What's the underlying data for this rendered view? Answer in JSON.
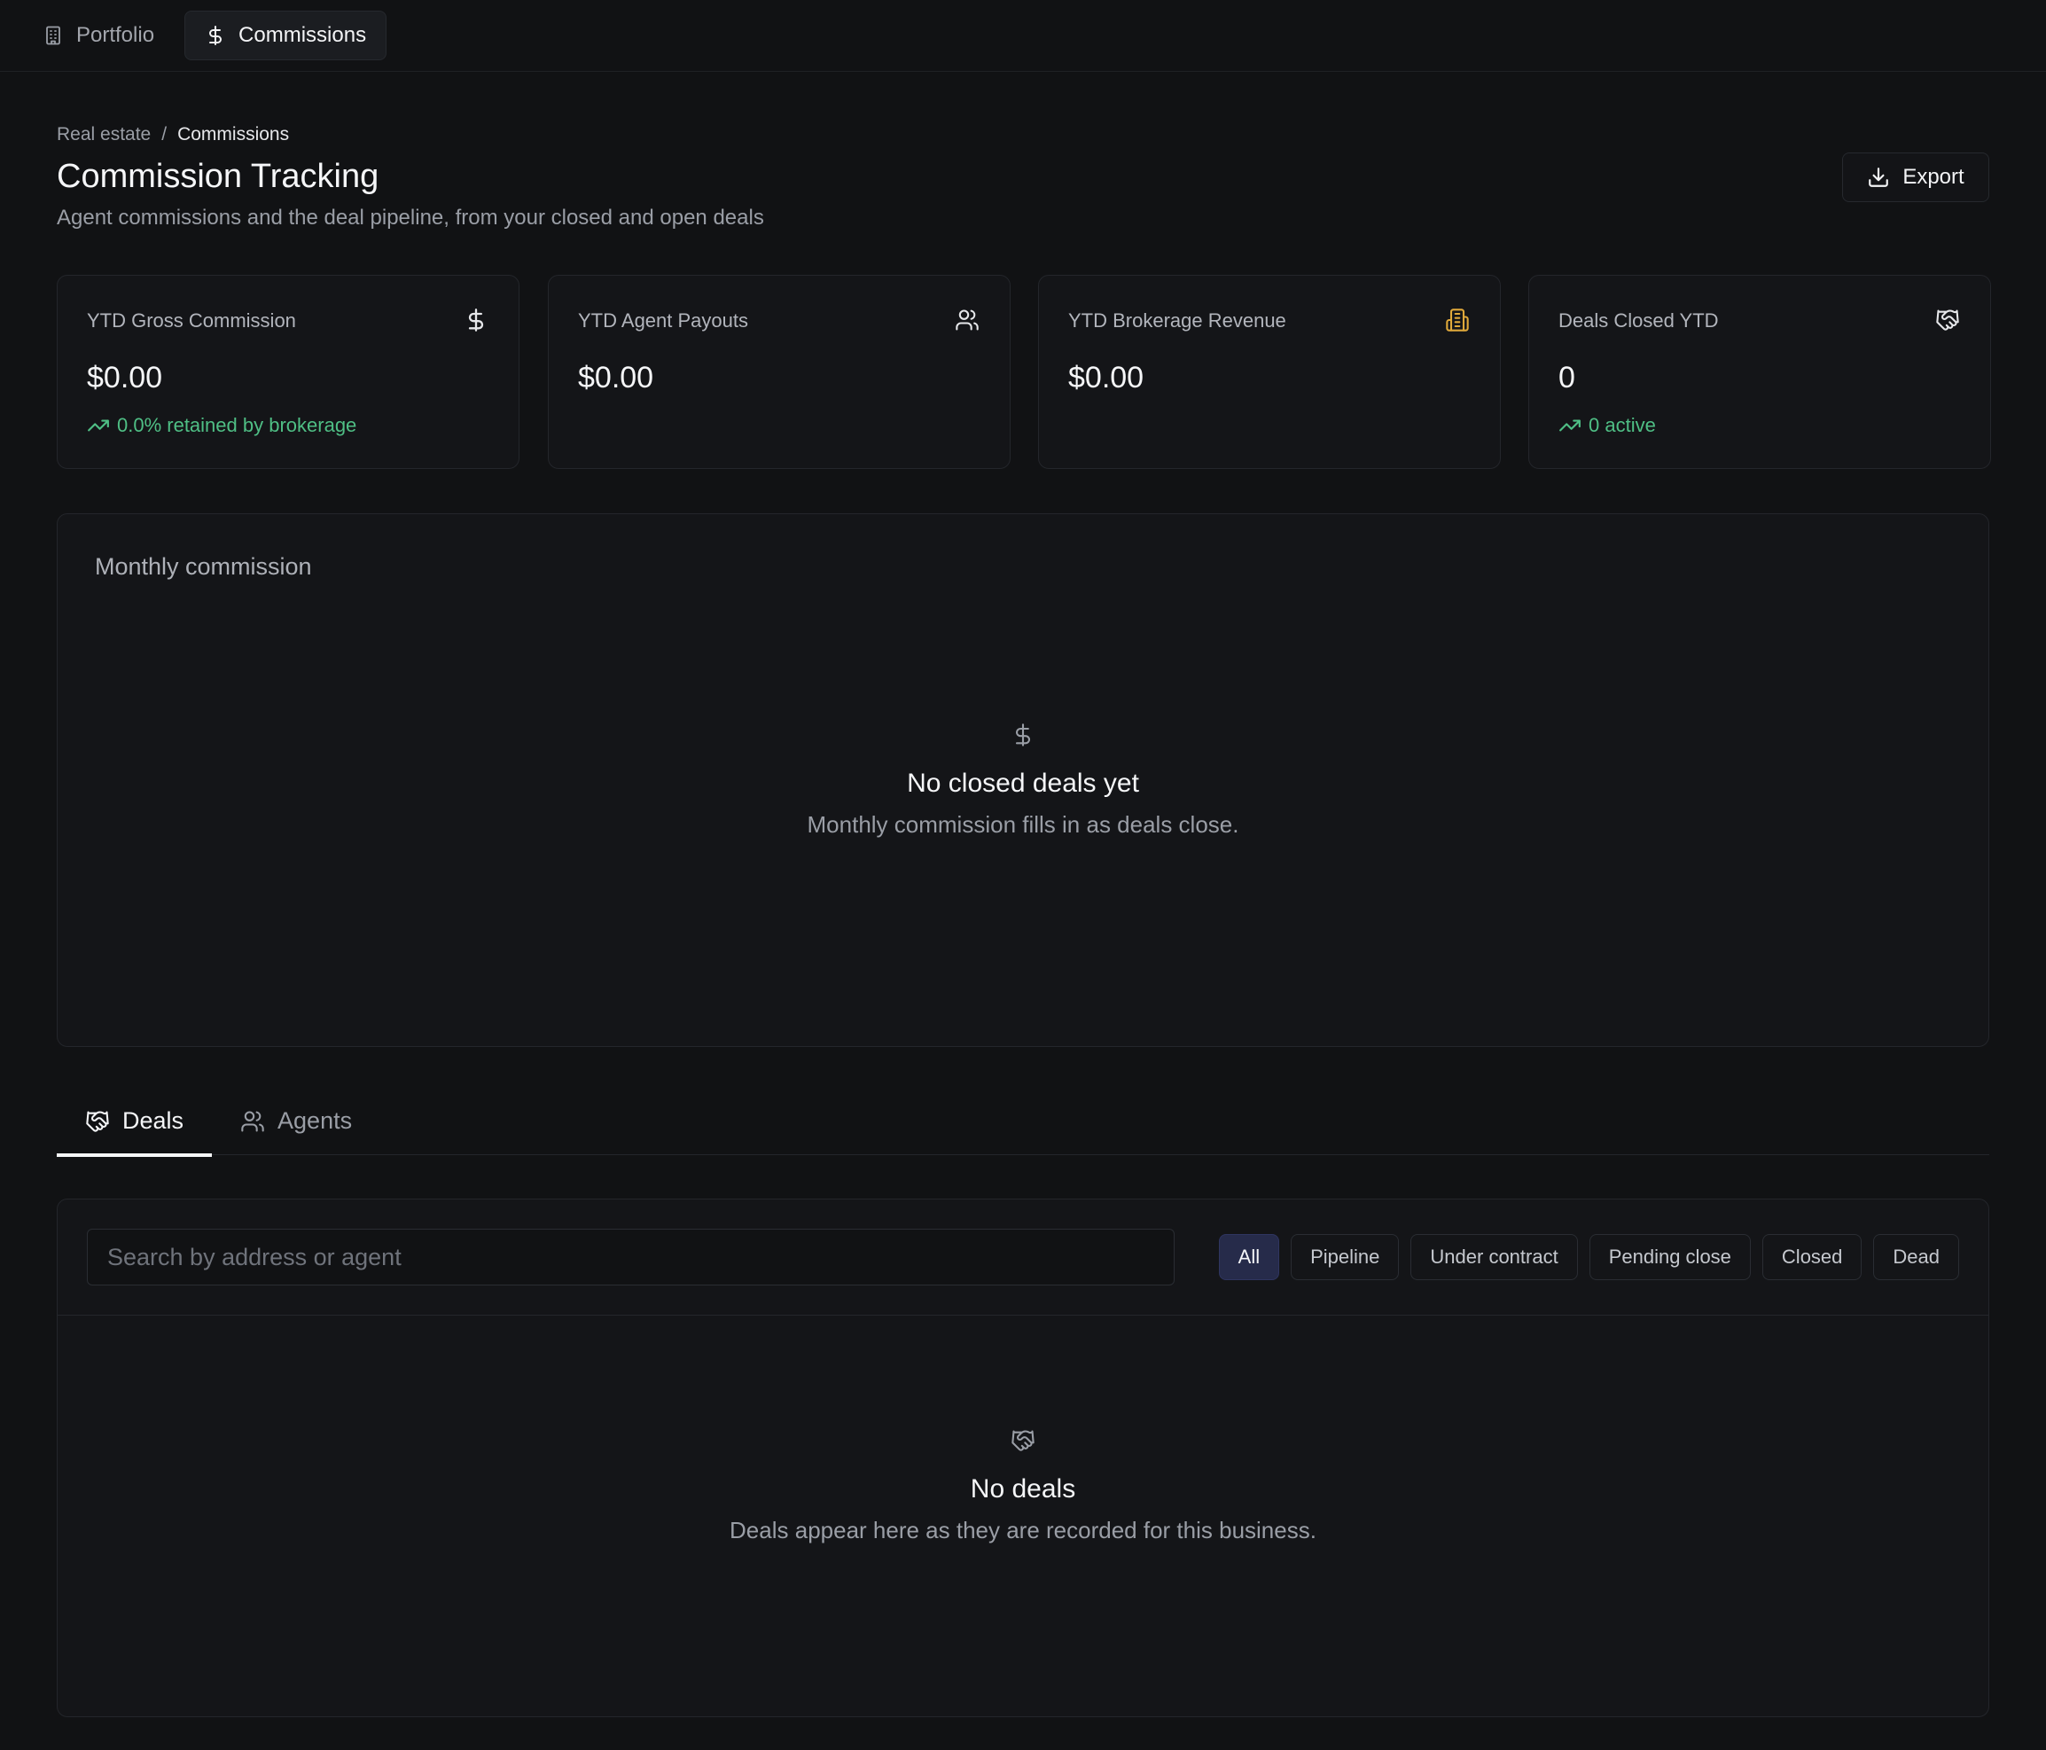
{
  "nav": {
    "tabs": [
      {
        "label": "Portfolio",
        "icon": "building-icon",
        "active": false
      },
      {
        "label": "Commissions",
        "icon": "dollar-icon",
        "active": true
      }
    ]
  },
  "breadcrumb": {
    "parent": "Real estate",
    "separator": "/",
    "current": "Commissions"
  },
  "header": {
    "title": "Commission Tracking",
    "subtitle": "Agent commissions and the deal pipeline, from your closed and open deals",
    "export_label": "Export"
  },
  "stats": [
    {
      "label": "YTD Gross Commission",
      "value": "$0.00",
      "trend": "0.0% retained by brokerage",
      "icon": "dollar-icon"
    },
    {
      "label": "YTD Agent Payouts",
      "value": "$0.00",
      "trend": "",
      "icon": "users-icon"
    },
    {
      "label": "YTD Brokerage Revenue",
      "value": "$0.00",
      "trend": "",
      "icon": "building-icon"
    },
    {
      "label": "Deals Closed YTD",
      "value": "0",
      "trend": "0 active",
      "icon": "handshake-icon"
    }
  ],
  "monthly": {
    "title": "Monthly commission",
    "empty_title": "No closed deals yet",
    "empty_sub": "Monthly commission fills in as deals close."
  },
  "tabs": [
    {
      "label": "Deals",
      "icon": "handshake-icon",
      "active": true
    },
    {
      "label": "Agents",
      "icon": "users-icon",
      "active": false
    }
  ],
  "deals": {
    "search_placeholder": "Search by address or agent",
    "filters": [
      "All",
      "Pipeline",
      "Under contract",
      "Pending close",
      "Closed",
      "Dead"
    ],
    "active_filter": "All",
    "empty_title": "No deals",
    "empty_sub": "Deals appear here as they are recorded for this business."
  },
  "colors": {
    "background": "#111214",
    "accent_green": "#4fbf85",
    "accent_amber": "#e0a93b",
    "active_chip": "#262b4a"
  }
}
